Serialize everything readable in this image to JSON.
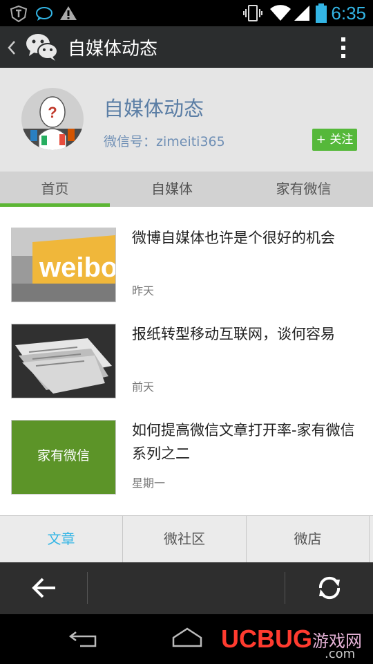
{
  "status_bar": {
    "time": "6:35"
  },
  "header": {
    "title": "自媒体动态"
  },
  "profile": {
    "name": "自媒体动态",
    "wechat_id": "微信号：zimeiti365",
    "follow_label": "+ 关注"
  },
  "tabs": [
    {
      "label": "首页",
      "active": true
    },
    {
      "label": "自媒体",
      "active": false
    },
    {
      "label": "家有微信",
      "active": false
    }
  ],
  "articles": [
    {
      "title": "微博自媒体也许是个很好的机会",
      "date": "昨天",
      "thumb_text": "weibo"
    },
    {
      "title": "报纸转型移动互联网，谈何容易",
      "date": "前天",
      "thumb_text": ""
    },
    {
      "title": "如何提高微信文章打开率-家有微信系列之二",
      "date": "星期一",
      "thumb_text": "家有微信"
    }
  ],
  "bottom_menu": [
    {
      "label": "文章",
      "active": true
    },
    {
      "label": "微社区",
      "active": false
    },
    {
      "label": "微店",
      "active": false
    }
  ],
  "watermark": {
    "brand": "UCBUG",
    "suffix": ".com",
    "cn": "游戏网"
  },
  "colors": {
    "accent_green": "#55b83a",
    "tab_indicator": "#5cb634",
    "link_blue": "#33b5e5",
    "name_blue": "#5b7ea5"
  }
}
